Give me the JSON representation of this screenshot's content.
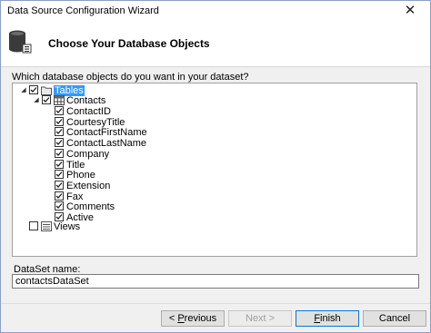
{
  "window": {
    "title": "Data Source Configuration Wizard",
    "close_glyph": "✕"
  },
  "header": {
    "title": "Choose Your Database Objects",
    "icon": "database-icon"
  },
  "question": "Which database objects do you want in your dataset?",
  "tree": {
    "tables_label": "Tables",
    "contacts_label": "Contacts",
    "columns": [
      "ContactID",
      "CourtesyTitle",
      "ContactFirstName",
      "ContactLastName",
      "Company",
      "Title",
      "Phone",
      "Extension",
      "Fax",
      "Comments",
      "Active"
    ],
    "views_label": "Views"
  },
  "dataset": {
    "label": "DataSet name:",
    "value": "contactsDataSet"
  },
  "buttons": {
    "previous": {
      "prefix": "< ",
      "underlined": "P",
      "rest": "revious"
    },
    "next": "Next >",
    "finish": {
      "underlined": "F",
      "rest": "inish"
    },
    "cancel": "Cancel"
  },
  "colors": {
    "selection": "#3399ff",
    "default_button_border": "#0078d7"
  }
}
